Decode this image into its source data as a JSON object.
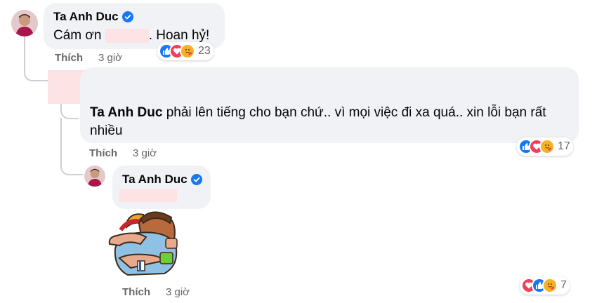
{
  "comment1": {
    "author": "Ta Anh Duc",
    "text_before": "Cám ơn",
    "text_after": ". Hoan hỷ!",
    "action": "Thích",
    "time": "3 giờ",
    "reaction_count": "23"
  },
  "comment2": {
    "author": "Ta Anh Duc",
    "text": "phải lên tiếng cho bạn chứ.. vì mọi việc đi xa quá.. xin lỗi bạn rất nhiều",
    "action": "Thích",
    "time": "3 giờ",
    "reaction_count": "17"
  },
  "comment3": {
    "author": "Ta Anh Duc",
    "sticker": "hug-sticker",
    "action": "Thích",
    "time": "3 giờ",
    "reaction_count": "7"
  },
  "colors": {
    "like": "#1877f2",
    "love": "#f33e58",
    "care": "#f7b125",
    "redaction": "#fde3e3"
  }
}
